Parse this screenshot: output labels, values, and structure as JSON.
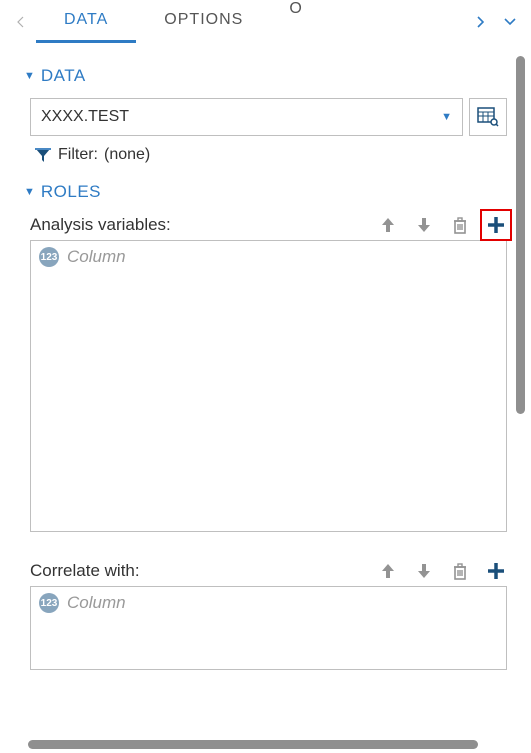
{
  "tabs": {
    "items": [
      {
        "label": "DATA",
        "active": true
      },
      {
        "label": "OPTIONS",
        "active": false
      }
    ],
    "overflow_hint": "O"
  },
  "sections": {
    "data": {
      "title": "DATA",
      "dataset": "XXXX.TEST",
      "filter_label": "Filter:",
      "filter_value": "(none)"
    },
    "roles": {
      "title": "ROLES",
      "analysis_label": "Analysis variables:",
      "analysis_placeholder": "Column",
      "correlate_label": "Correlate with:",
      "correlate_placeholder": "Column"
    }
  },
  "badges": {
    "numeric": "123"
  }
}
